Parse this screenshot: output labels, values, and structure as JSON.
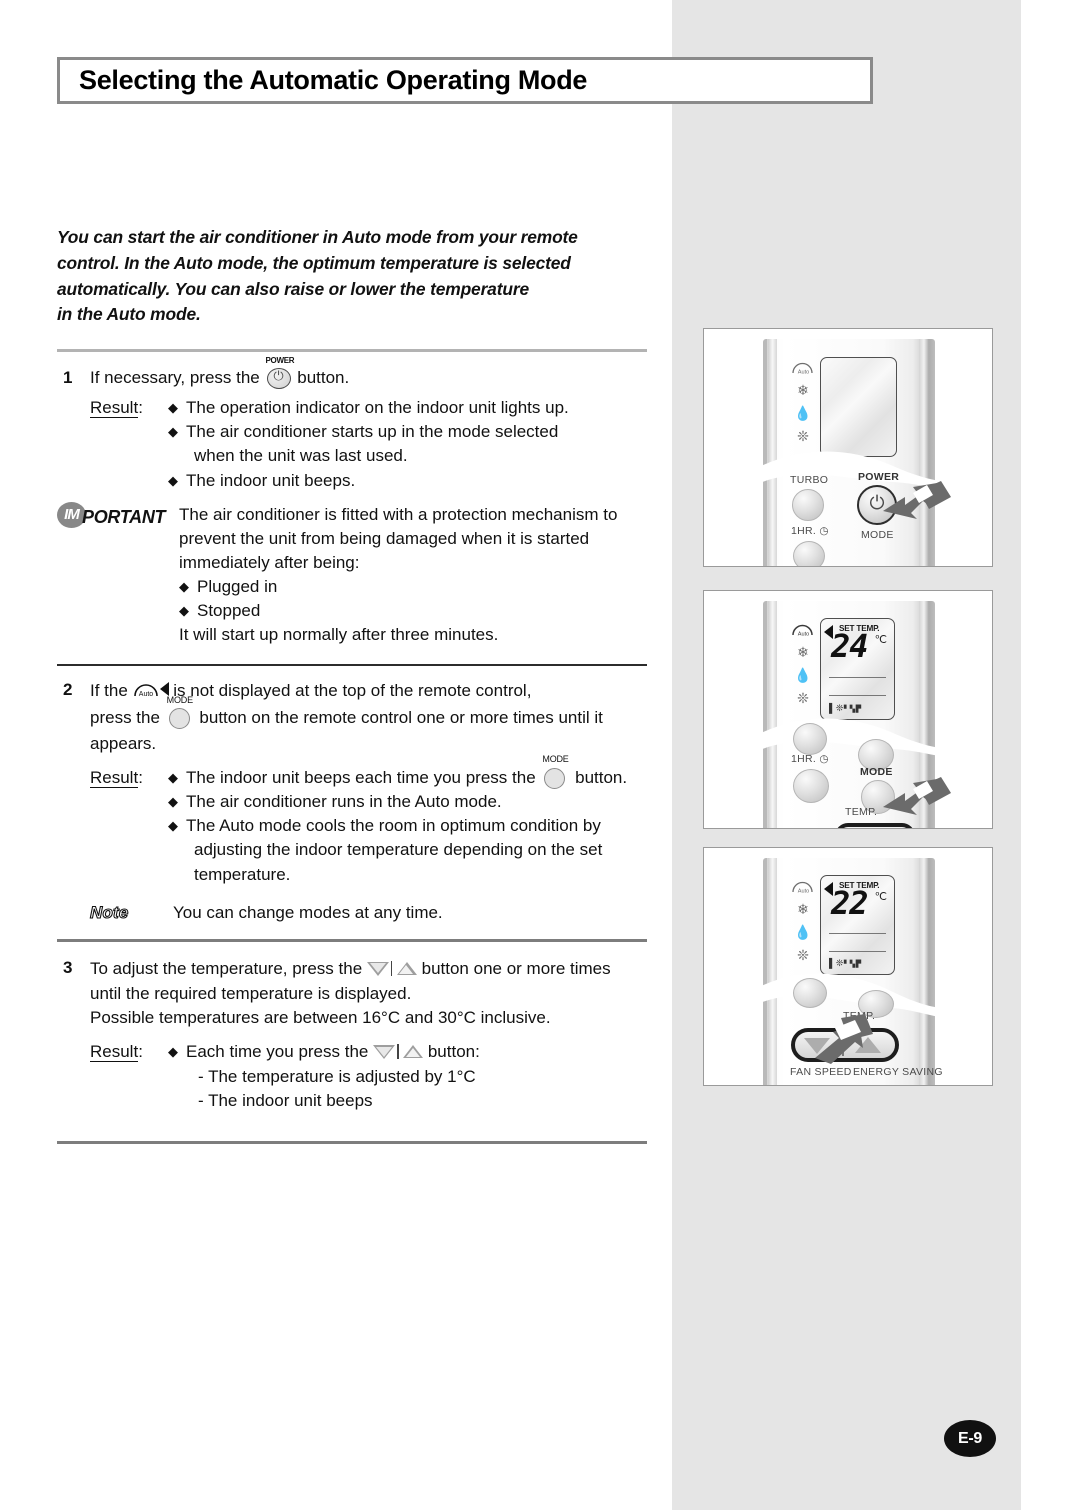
{
  "page": {
    "title": "Selecting the Automatic Operating Mode",
    "page_number": "E-9",
    "colors": {
      "side_band": "#e5e5e5",
      "title_border": "#8a8a8a",
      "rule_light": "#b3b3b3",
      "rule_dark": "#2c2c2c",
      "page_badge": "#111111"
    }
  },
  "intro": {
    "line1": "You can start the air conditioner in Auto mode from your remote",
    "line2": "control. In the Auto mode, the optimum temperature is selected",
    "line3": "automatically. You can also raise or lower the temperature",
    "line4": "in the Auto mode."
  },
  "steps": [
    {
      "number": "1",
      "text_before": "If necessary, press the",
      "text_after": "button.",
      "icon": "power-button-icon",
      "icon_label": "POWER",
      "result_label": "Result",
      "result_colon": ":",
      "bullets": [
        {
          "line1": "The operation indicator on the indoor unit lights up."
        },
        {
          "line1": "The air conditioner starts up in the mode selected",
          "line2": "when the unit was last used."
        },
        {
          "line1": "The indoor unit beeps."
        }
      ]
    },
    {
      "number": "2",
      "line1_a": "If the",
      "line1_b": "is not displayed at the top of the remote control,",
      "line2_a": "press the",
      "line2_b": "button on the remote control one or more times until it",
      "line3": "appears.",
      "icon_auto": "auto-mode-indicator-icon",
      "icon_mode": "mode-button-icon",
      "icon_mode_label": "MODE",
      "result_label": "Result",
      "result_colon": ":",
      "bullets": [
        {
          "line1_a": "The indoor unit beeps each time you press the",
          "line1_b": "button."
        },
        {
          "line1": "The air conditioner runs in the Auto mode."
        },
        {
          "line1": "The Auto mode cools the room in optimum condition by",
          "line2": "adjusting the indoor temperature depending on the set",
          "line3": "temperature."
        }
      ]
    },
    {
      "number": "3",
      "line1_a": "To adjust the temperature, press the",
      "line1_b": "button one or more times",
      "line2": "until the required temperature is displayed.",
      "line3": "Possible temperatures are between 16°C and 30°C inclusive.",
      "icon_temp": "temperature-updown-button-icon",
      "result_label": "Result",
      "result_colon": ":",
      "bullets": [
        {
          "line1_a": "Each time you press the",
          "line1_b": "button:"
        }
      ],
      "sub_items": [
        "- The temperature is adjusted by 1°C",
        "- The indoor unit beeps"
      ]
    }
  ],
  "important": {
    "badge_letters": "IM",
    "word": "PORTANT",
    "line1": "The air conditioner is fitted with a protection mechanism to",
    "line2": "prevent the unit from being damaged when it is started",
    "line3": "immediately after being:",
    "bullets": [
      "Plugged in",
      "Stopped"
    ],
    "line4": "It will start up normally after three minutes."
  },
  "note": {
    "tag": "Note",
    "text": "You can change modes at any time."
  },
  "illustrations": [
    {
      "id": "panel-power",
      "caption_buttons": [
        "TURBO",
        "POWER",
        "1HR.",
        "MODE"
      ],
      "display": {
        "set_temp_label": "",
        "temperature": "",
        "unit": ""
      },
      "mode_icons": [
        "auto-mode-icon",
        "cool-snowflake-icon",
        "dry-droplet-icon",
        "fan-icon"
      ],
      "highlighted_button": "POWER",
      "pointer": "hand-pointer-arrow-icon"
    },
    {
      "id": "panel-mode",
      "caption_buttons": [
        "1HR.",
        "MODE",
        "TEMP."
      ],
      "display": {
        "set_temp_label": "SET TEMP.",
        "temperature": "24",
        "unit": "℃"
      },
      "mode_icons": [
        "auto-mode-icon",
        "cool-snowflake-icon",
        "dry-droplet-icon",
        "fan-icon"
      ],
      "highlighted_button": "MODE",
      "pointer": "hand-pointer-arrow-icon"
    },
    {
      "id": "panel-temp",
      "caption_buttons": [
        "TEMP.",
        "FAN SPEED",
        "ENERGY SAVING"
      ],
      "display": {
        "set_temp_label": "SET TEMP.",
        "temperature": "22",
        "unit": "℃"
      },
      "mode_icons": [
        "auto-mode-icon",
        "cool-snowflake-icon",
        "dry-droplet-icon",
        "fan-icon"
      ],
      "highlighted_button": "TEMP. down/up",
      "pointer": "hand-pointer-arrow-icon"
    }
  ],
  "glyphs": {
    "diamond": "◆",
    "auto_text": "Auto",
    "fan_bars": "▐▒▄█"
  }
}
